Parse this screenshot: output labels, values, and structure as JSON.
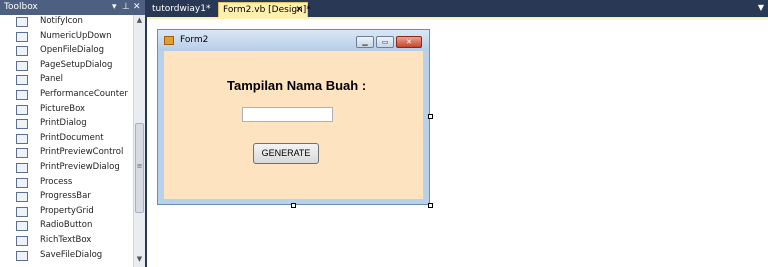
{
  "toolbox": {
    "title": "Toolbox",
    "pin_icon": "pin-icon",
    "close_icon": "close-icon",
    "items": [
      {
        "label": "NotifyIcon"
      },
      {
        "label": "NumericUpDown"
      },
      {
        "label": "OpenFileDialog"
      },
      {
        "label": "PageSetupDialog"
      },
      {
        "label": "Panel"
      },
      {
        "label": "PerformanceCounter"
      },
      {
        "label": "PictureBox"
      },
      {
        "label": "PrintDialog"
      },
      {
        "label": "PrintDocument"
      },
      {
        "label": "PrintPreviewControl"
      },
      {
        "label": "PrintPreviewDialog"
      },
      {
        "label": "Process"
      },
      {
        "label": "ProgressBar"
      },
      {
        "label": "PropertyGrid"
      },
      {
        "label": "RadioButton"
      },
      {
        "label": "RichTextBox"
      },
      {
        "label": "SaveFileDialog"
      }
    ]
  },
  "tabs": [
    {
      "label": "tutordwiay1*",
      "active": false
    },
    {
      "label": "Form2.vb [Design]*",
      "active": true
    }
  ],
  "form": {
    "title": "Form2",
    "label_text": "Tampilan Nama Buah :",
    "textbox_value": "",
    "button_label": "GENERATE"
  },
  "colors": {
    "ide_background": "#293955",
    "active_tab": "#fff0b0",
    "form_client": "#fde3c0"
  }
}
